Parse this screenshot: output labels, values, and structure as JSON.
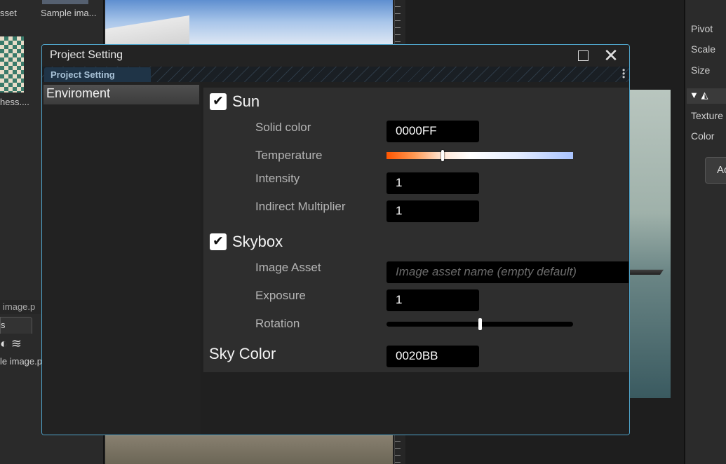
{
  "background": {
    "asset_labels": [
      "sset",
      "Sample ima...",
      "hess...."
    ],
    "path_label": "image.p",
    "tab_label": "s",
    "asset_name": "le image.p"
  },
  "inspector": {
    "labels": [
      "Pivot",
      "Scale",
      "Size",
      "Texture",
      "Color"
    ],
    "button_label": "Ac"
  },
  "window": {
    "title": "Project Setting",
    "tab_label": "Project Setting",
    "sidebar": {
      "items": [
        {
          "label": "Enviroment"
        }
      ]
    },
    "sun": {
      "title": "Sun",
      "checked": true,
      "fields": {
        "solid_color": {
          "label": "Solid color",
          "value": "0000FF"
        },
        "temperature": {
          "label": "Temperature",
          "position": 0.3
        },
        "intensity": {
          "label": "Intensity",
          "value": "1"
        },
        "indirect_multiplier": {
          "label": "Indirect Multiplier",
          "value": "1"
        }
      }
    },
    "skybox": {
      "title": "Skybox",
      "checked": true,
      "fields": {
        "image_asset": {
          "label": "Image Asset",
          "placeholder": "Image asset name (empty default)"
        },
        "exposure": {
          "label": "Exposure",
          "value": "1"
        },
        "rotation": {
          "label": "Rotation",
          "position": 0.5
        }
      }
    },
    "sky_color": {
      "label": "Sky Color",
      "value": "0020BB"
    }
  },
  "colors": {
    "window_border": "#4fa3c9",
    "tab_bg": "#1f3447",
    "panel_bg": "#2e2e2e"
  }
}
